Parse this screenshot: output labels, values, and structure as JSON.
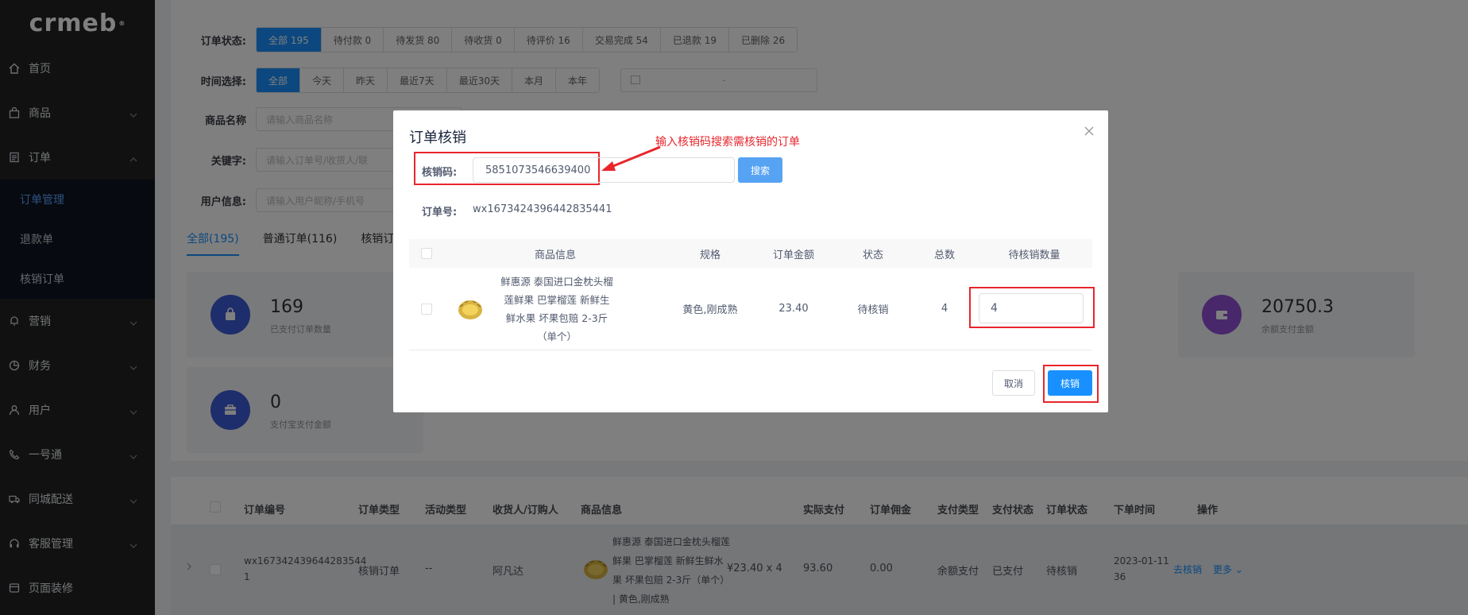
{
  "sidebar": {
    "logo": "crmeb",
    "logo_mark": "®",
    "items": [
      {
        "label": "首页",
        "icon": "home-icon"
      },
      {
        "label": "商品",
        "icon": "bag-icon"
      },
      {
        "label": "订单",
        "icon": "document-icon"
      },
      {
        "label": "营销",
        "icon": "bell-icon"
      },
      {
        "label": "财务",
        "icon": "pie-icon"
      },
      {
        "label": "用户",
        "icon": "user-icon"
      },
      {
        "label": "一号通",
        "icon": "phone-icon"
      },
      {
        "label": "同城配送",
        "icon": "truck-icon"
      },
      {
        "label": "客服管理",
        "icon": "headset-icon"
      },
      {
        "label": "页面装修",
        "icon": "layout-icon"
      }
    ],
    "sub_items": [
      "订单管理",
      "退款单",
      "核销订单"
    ]
  },
  "filters": {
    "status_label": "订单状态:",
    "status_options": [
      "全部 195",
      "待付款 0",
      "待发货 80",
      "待收货 0",
      "待评价 16",
      "交易完成 54",
      "已退款 19",
      "已删除 26"
    ],
    "time_label": "时间选择:",
    "time_options": [
      "全部",
      "今天",
      "昨天",
      "最近7天",
      "最近30天",
      "本月",
      "本年"
    ],
    "date_sep": "-",
    "product_label": "商品名称",
    "product_placeholder": "请输入商品名称",
    "keyword_label": "关键字:",
    "keyword_placeholder": "请输入订单号/收货人/联",
    "user_label": "用户信息:",
    "user_placeholder": "请输入用户昵称/手机号"
  },
  "tabs": [
    "全部(195)",
    "普通订单(116)",
    "核销订"
  ],
  "stats": [
    {
      "value": "169",
      "label": "已支付订单数量",
      "color": "#3d5ad6"
    },
    {
      "value": "20750.3",
      "label": "余额支付金额",
      "color": "#9150d6"
    },
    {
      "value": "0",
      "label": "支付宝支付金额",
      "color": "#3d5ad6"
    }
  ],
  "orders_table": {
    "headers": [
      "订单编号",
      "订单类型",
      "活动类型",
      "收货人/订购人",
      "商品信息",
      "实际支付",
      "订单佣金",
      "支付类型",
      "支付状态",
      "订单状态",
      "下单时间",
      "操作"
    ],
    "row": {
      "order_no_line1": "wx167342439644283544",
      "order_no_line2": "1",
      "type": "核销订单",
      "activity": "--",
      "buyer": "阿凡达",
      "product": [
        "鲜惠源 泰国进口金枕头榴莲",
        "鲜果 巴掌榴莲 新鲜生鲜水",
        "果 坏果包赔 2-3斤（单个）",
        "| 黄色,刚成熟"
      ],
      "price": "¥23.40 x 4",
      "paid": "93.60",
      "commission": "0.00",
      "pay_type": "余额支付",
      "pay_status": "已支付",
      "order_status": "待核销",
      "time_line1": "2023-01-11",
      "time_line2": "36",
      "action_verify": "去核销",
      "action_more": "更多"
    }
  },
  "modal": {
    "title": "订单核销",
    "annotation": "输入核销码搜索需核销的订单",
    "code_label": "核销码:",
    "code_value": "5851073546639400",
    "search_label": "搜索",
    "order_no_label": "订单号:",
    "order_no_value": "wx1673424396442835441",
    "headers": [
      "商品信息",
      "规格",
      "订单金额",
      "状态",
      "总数",
      "待核销数量"
    ],
    "row": {
      "product": [
        "鲜惠源 泰国进口金枕头榴",
        "莲鲜果 巴掌榴莲 新鲜生",
        "鲜水果 坏果包赔 2-3斤",
        "（单个）"
      ],
      "spec": "黄色,刚成熟",
      "amount": "23.40",
      "status": "待核销",
      "total": "4",
      "pending_qty": "4"
    },
    "cancel_label": "取消",
    "confirm_label": "核销",
    "accent_color": "#1890ff",
    "highlight_color": "#e8262c"
  }
}
